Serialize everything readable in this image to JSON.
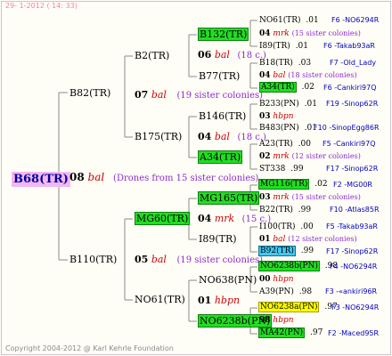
{
  "header": "29- 1-2012 ( 14: 33)",
  "copyright": "Copyright 2004-2012 @ Karl Kehrle Foundation",
  "root": {
    "name": "B68(TR)",
    "year": "08",
    "breeder": "bal",
    "note": "(Drones from 15 sister colonies)"
  },
  "gen1": [
    {
      "name": "B82(TR)"
    },
    {
      "name": "B110(TR)"
    }
  ],
  "gen2": [
    {
      "name": "B2(TR)"
    },
    {
      "name": "B175(TR)"
    },
    {
      "name": "MG60(TR)"
    },
    {
      "name": "NO61(TR)"
    }
  ],
  "gen2_mid": [
    {
      "year": "07",
      "breeder": "bal",
      "note": "(19 sister colonies)"
    },
    {
      "year": "05",
      "breeder": "bal",
      "note": "(19 sister colonies)"
    }
  ],
  "gen3": [
    {
      "name": "B132(TR)"
    },
    {
      "name": "B77(TR)"
    },
    {
      "name": "B146(TR)"
    },
    {
      "name": "A34(TR)"
    },
    {
      "name": "MG165(TR)"
    },
    {
      "name": "I89(TR)"
    },
    {
      "name": "NO638(PN)"
    },
    {
      "name": "NO6238b(PN)"
    }
  ],
  "gen3_mid": [
    {
      "year": "06",
      "breeder": "bal",
      "note": "(18 c.)"
    },
    {
      "year": "04",
      "breeder": "bal",
      "note": "(18 c.)"
    },
    {
      "year": "04",
      "breeder": "mrk",
      "note": "(15 c.)"
    },
    {
      "year": "01",
      "breeder": "hbpn",
      "note": ""
    }
  ],
  "gen4": [
    {
      "name": "NO61(TR)",
      "val": ".01",
      "info": "F6 -NO6294R"
    },
    {
      "year": "04",
      "breeder": "mrk",
      "note": "(15 sister colonies)"
    },
    {
      "name": "I89(TR)",
      "val": ".01",
      "info": "F6 -Takab93aR"
    },
    {
      "name": "B18(TR)",
      "val": ".03",
      "info": "F7 -Old_Lady"
    },
    {
      "year": "04",
      "breeder": "bal",
      "note": "(18 sister colonies)"
    },
    {
      "name": "A34(TR)",
      "val": ".02",
      "info": "F6 -Cankiri97Q"
    },
    {
      "name": "B233(PN)",
      "val": ".01",
      "info": "F19 -Sinop62R"
    },
    {
      "year": "03",
      "breeder": "hbpn",
      "note": ""
    },
    {
      "name": "B483(PN)",
      "val": ".01",
      "info": "F10 -SinopEgg86R"
    },
    {
      "name": "A23(TR)",
      "val": ".00",
      "info": "F5 -Cankiri97Q"
    },
    {
      "year": "02",
      "breeder": "mrk",
      "note": "(12 sister colonies)"
    },
    {
      "name": "ST338",
      "val": ".99",
      "info": "F17 -Sinop62R"
    },
    {
      "name": "MG116(TR)",
      "val": ".02",
      "info": "F2 -MG00R"
    },
    {
      "year": "03",
      "breeder": "mrk",
      "note": "(15 sister colonies)"
    },
    {
      "name": "B22(TR)",
      "val": ".99",
      "info": "F10 -Atlas85R"
    },
    {
      "name": "I100(TR)",
      "val": ".00",
      "info": "F5 -Takab93aR"
    },
    {
      "year": "01",
      "breeder": "bal",
      "note": "(12 sister colonies)"
    },
    {
      "name": "B92(TR)",
      "val": ".99",
      "info": "F17 -Sinop62R"
    },
    {
      "name": "NO6238b(PN)",
      "val": ".98",
      "info": "F4 -NO6294R"
    },
    {
      "year": "00",
      "breeder": "hbpn",
      "note": ""
    },
    {
      "name": "A39(PN)",
      "val": ".98",
      "info": "F3 -«ankiri96R"
    },
    {
      "name": "NO6238a(PN)",
      "val": ".97",
      "info": "F3 -NO6294R"
    },
    {
      "year": "98",
      "breeder": "hbpn",
      "note": ""
    },
    {
      "name": "MA42(PN)",
      "val": ".97",
      "info": "F2 -Maced95R"
    }
  ]
}
